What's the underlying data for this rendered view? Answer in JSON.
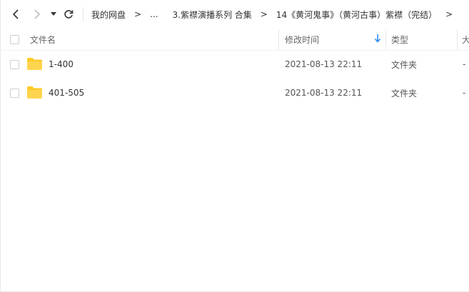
{
  "breadcrumbs": {
    "root": "我的网盘",
    "more": "...",
    "items": [
      "3.紫襟演播系列 合集",
      "14《黄河鬼事》（黄河古事）紫襟（完结）"
    ],
    "separator": ">"
  },
  "columns": {
    "name": "文件名",
    "modified": "修改时间",
    "type": "类型",
    "size": "大"
  },
  "sort": {
    "column": "modified",
    "direction": "descending",
    "icon": "sort-down-arrow-icon",
    "color": "#2d8cf0"
  },
  "rows": [
    {
      "name": "1-400",
      "modified": "2021-08-13 22:11",
      "type": "文件夹",
      "size": "-"
    },
    {
      "name": "401-505",
      "modified": "2021-08-13 22:11",
      "type": "文件夹",
      "size": "-"
    }
  ],
  "colors": {
    "folder": "#ffd54f",
    "folder_tab": "#ffca28"
  }
}
